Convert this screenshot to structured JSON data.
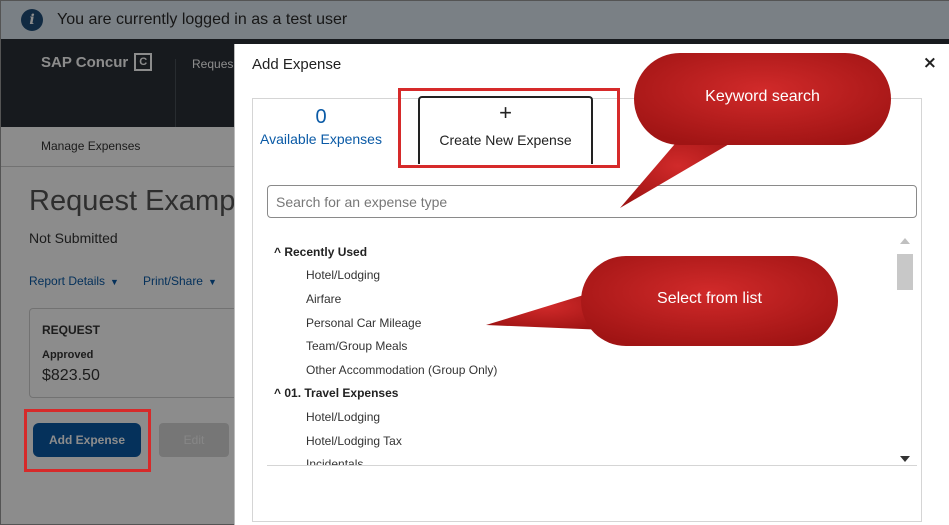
{
  "banner": {
    "text": "You are currently logged in as a test user"
  },
  "nav": {
    "brand": "SAP Concur",
    "brand_mark": "C",
    "item": "Reques"
  },
  "subnav": {
    "item": "Manage Expenses"
  },
  "report": {
    "title": "Request Exampl",
    "status": "Not Submitted",
    "actions": [
      "Report Details",
      "Print/Share"
    ],
    "card": {
      "label": "REQUEST",
      "status": "Approved",
      "amount": "$823.50"
    }
  },
  "buttons": {
    "add_expense": "Add Expense",
    "edit": "Edit"
  },
  "modal": {
    "title": "Add Expense",
    "close": "×",
    "tabs": {
      "available_count": "0",
      "available_label": "Available Expenses",
      "create_plus": "+",
      "create_label": "Create New Expense"
    },
    "search": {
      "placeholder": "Search for an expense type",
      "value": ""
    },
    "list": {
      "groups": [
        {
          "label": "^ Recently Used",
          "items": [
            "Hotel/Lodging",
            "Airfare",
            "Personal Car Mileage",
            "Team/Group Meals",
            "Other Accommodation (Group Only)"
          ]
        },
        {
          "label": "^ 01. Travel Expenses",
          "items": [
            "Hotel/Lodging",
            "Hotel/Lodging Tax",
            "Incidentals"
          ]
        }
      ]
    }
  },
  "callouts": {
    "keyword": "Keyword search",
    "select": "Select from list",
    "color": "#c41f1f"
  },
  "colors": {
    "highlight": "#d62a2a",
    "link": "#0a5aa6",
    "nav_bg": "#2b3038"
  }
}
